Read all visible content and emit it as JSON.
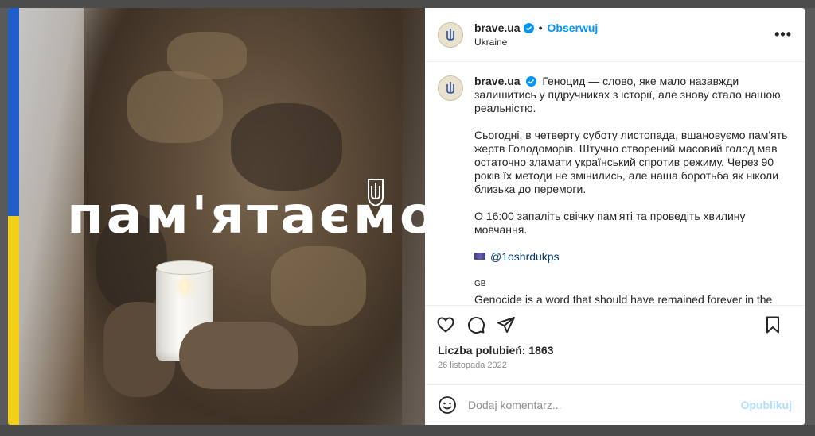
{
  "post": {
    "headline": "пам'ятаємо",
    "account": {
      "username": "brave.ua",
      "location": "Ukraine",
      "follow_label": "Obserwuj",
      "separator": "•"
    },
    "more_label": "•••",
    "caption": {
      "username": "brave.ua",
      "p1": "Геноцид — слово, яке мало назавжди залишитись у підручниках з історії, але знову стало нашою реальністю.",
      "p2": "Сьогодні, в четверту суботу листопада, вшановуємо пам'ять жертв Голодоморів. Штучно створений масовий голод мав остаточно зламати український спротив режиму. Через 90 років їх методи не змінились, але наша боротьба як ніколи близька до перемоги.",
      "p3": "О 16:00 запаліть свічку пам'яті та проведіть хвилину мовчання.",
      "mention": "@1oshrdukps",
      "gb_label": "GB",
      "p4": "Genocide is a word that should have remained forever in the history books but has become our reality again."
    },
    "likes": "Liczba polubień: 1863",
    "date": "26 listopada 2022",
    "comment": {
      "placeholder": "Dodaj komentarz...",
      "post_label": "Opublikuj"
    },
    "icons": {
      "like": "heart-icon",
      "comment": "comment-icon",
      "share": "share-icon",
      "save": "bookmark-icon",
      "emoji": "emoji-icon",
      "verified": "verified-badge-icon",
      "avatar": "trident-icon"
    },
    "colors": {
      "flag_blue": "#1f5ec9",
      "flag_yellow": "#f4cf1a",
      "link": "#0095f6",
      "post_disabled": "#b2dffc"
    }
  }
}
